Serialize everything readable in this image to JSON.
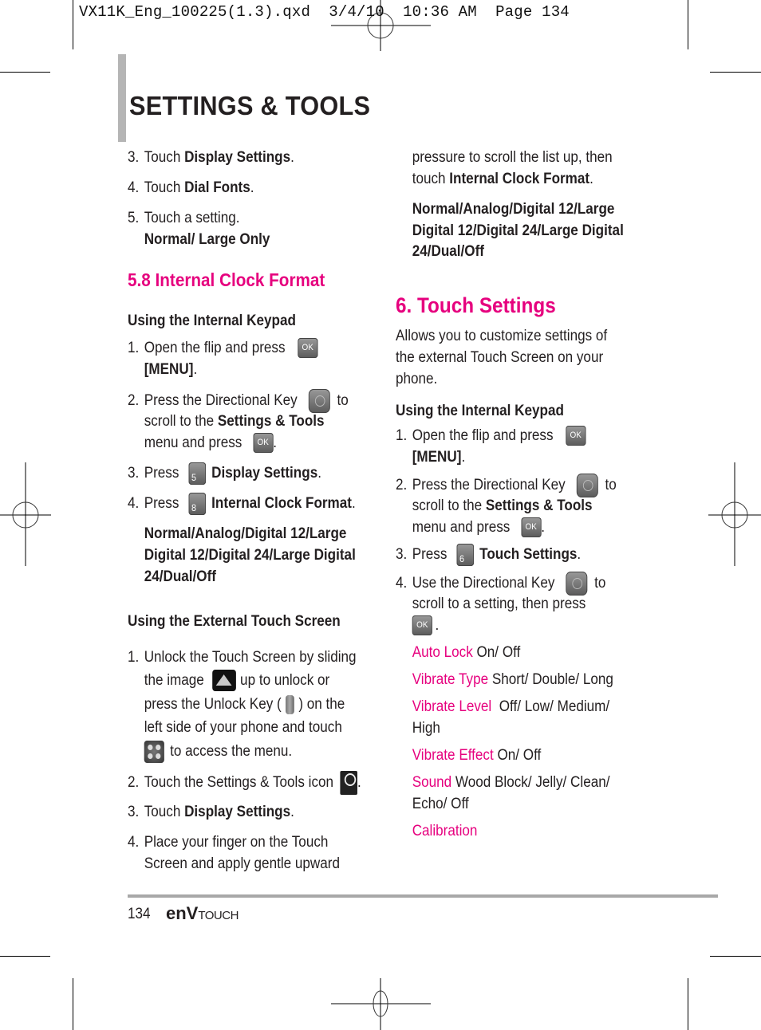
{
  "slug": "VX11K_Eng_100225(1.3).qxd  3/4/10  10:36 AM  Page 134",
  "page_title": "SETTINGS & TOOLS",
  "left": {
    "steps_a": [
      {
        "num": "3.",
        "pre": "Touch ",
        "bold": "Display Settings",
        "post": "."
      },
      {
        "num": "4.",
        "pre": "Touch ",
        "bold": "Dial Fonts",
        "post": "."
      },
      {
        "num": "5.",
        "pre": "Touch a setting.",
        "bold": "",
        "post": ""
      }
    ],
    "dial_options": "Normal/ Large Only",
    "section_heading": "5.8 Internal Clock Format",
    "internal_heading": "Using the Internal Keypad",
    "internal_steps": {
      "s1_num": "1.",
      "s1_pre": "Open the flip and press",
      "s1_bold": "[MENU]",
      "s1_post": ".",
      "s2_num": "2.",
      "s2_pre": "Press the Directional Key",
      "s2_to": "to",
      "s2_line2_pre": "scroll to the ",
      "s2_bold": "Settings & Tools",
      "s2_line3": "menu and press",
      "s2_post": ".",
      "s3_num": "3.",
      "s3_pre": "Press",
      "s3_key": "5",
      "s3_bold": "Display Settings",
      "s3_post": ".",
      "s4_num": "4.",
      "s4_pre": "Press",
      "s4_key": "8",
      "s4_bold": "Internal Clock Format",
      "s4_post": "."
    },
    "clock_options": [
      "Normal/Analog/Digital 12/Large",
      "Digital 12/Digital 24/Large Digital",
      "24/Dual/Off"
    ],
    "external_heading": "Using the External Touch Screen",
    "external_steps": {
      "s1_num": "1.",
      "s1_l1": "Unlock the Touch Screen by sliding",
      "s1_l2_pre": "the image",
      "s1_l2_post": "up to unlock or",
      "s1_l3_pre": "press the Unlock Key (",
      "s1_l3_post": ") on the",
      "s1_l4": "left side of your phone and touch",
      "s1_l5": "to access the menu.",
      "s2_num": "2.",
      "s2_text": "Touch the Settings & Tools icon",
      "s2_post": ".",
      "s3_num": "3.",
      "s3_pre": "Touch ",
      "s3_bold": "Display Settings",
      "s3_post": ".",
      "s4_num": "4.",
      "s4_l1": "Place your finger on the Touch",
      "s4_l2": "Screen and apply gentle upward"
    }
  },
  "right": {
    "cont_l1": "pressure to scroll the list up, then",
    "cont_l2_pre": "touch ",
    "cont_l2_bold": "Internal Clock Format",
    "cont_l2_post": ".",
    "clock_options": [
      "Normal/Analog/Digital 12/Large",
      "Digital 12/Digital 24/Large Digital",
      "24/Dual/Off"
    ],
    "section_heading": "6. Touch Settings",
    "intro": [
      "Allows you to customize settings of",
      "the external Touch Screen on your",
      "phone."
    ],
    "internal_heading": "Using the Internal Keypad",
    "steps": {
      "s1_num": "1.",
      "s1_pre": "Open the flip and press",
      "s1_bold": "[MENU]",
      "s1_post": ".",
      "s2_num": "2.",
      "s2_pre": "Press the Directional Key",
      "s2_to": "to",
      "s2_line2_pre": "scroll to the ",
      "s2_bold": "Settings & Tools",
      "s2_line3": "menu and press",
      "s2_post": ".",
      "s3_num": "3.",
      "s3_pre": "Press",
      "s3_key": "6",
      "s3_bold": "Touch Settings",
      "s3_post": ".",
      "s4_num": "4.",
      "s4_pre": "Use the Directional Key",
      "s4_to": "to",
      "s4_l2": "scroll to a setting, then press",
      "s4_post": "."
    },
    "settings": [
      {
        "name": "Auto Lock",
        "values": " On/ Off"
      },
      {
        "name": "Vibrate Type",
        "values": " Short/ Double/ Long"
      },
      {
        "name": "Vibrate Level",
        "values": "  Off/ Low/ Medium/",
        "values_l2": "High"
      },
      {
        "name": "Vibrate Effect",
        "values": " On/ Off"
      },
      {
        "name": "Sound",
        "values": " Wood Block/ Jelly/ Clean/",
        "values_l2": "Echo/ Off"
      },
      {
        "name": "Calibration",
        "values": ""
      }
    ]
  },
  "icons": {
    "ok_label": "OK"
  },
  "footer": {
    "page_number": "134",
    "logo_brand": "enV",
    "logo_suffix": "TOUCH"
  },
  "colors": {
    "accent": "#e6007e",
    "text": "#231f20",
    "rule": "#a8a8a8"
  }
}
